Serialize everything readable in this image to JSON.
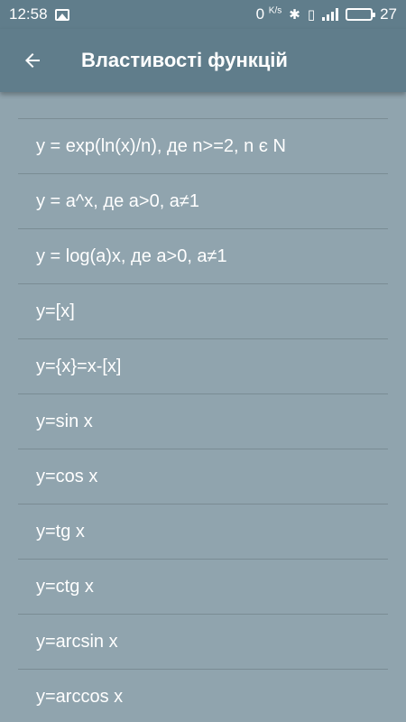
{
  "status_bar": {
    "time": "12:58",
    "net_speed": "0",
    "net_unit": "K/s",
    "battery": "27",
    "icons": [
      "image-icon",
      "bluetooth-icon",
      "vibrate-icon",
      "signal-icon",
      "battery-icon"
    ]
  },
  "app_bar": {
    "title": "Властивості функцій",
    "back_icon": "arrow-back-icon"
  },
  "colors": {
    "app_bar": "#607d8b",
    "background": "#90a4ae",
    "divider": "#7a8c94",
    "text": "#ffffff"
  },
  "items": [
    {
      "label": "y = exp(ln(x)/n), де n>=2, n є N"
    },
    {
      "label": "y = a^x, де a>0, a≠1"
    },
    {
      "label": "y = log(a)x, де a>0, a≠1"
    },
    {
      "label": "y=[x]"
    },
    {
      "label": "y={x}=x-[x]"
    },
    {
      "label": "y=sin x"
    },
    {
      "label": "y=cos x"
    },
    {
      "label": "y=tg x"
    },
    {
      "label": "y=ctg x"
    },
    {
      "label": "y=arcsin x"
    },
    {
      "label": "y=arccos x"
    }
  ]
}
